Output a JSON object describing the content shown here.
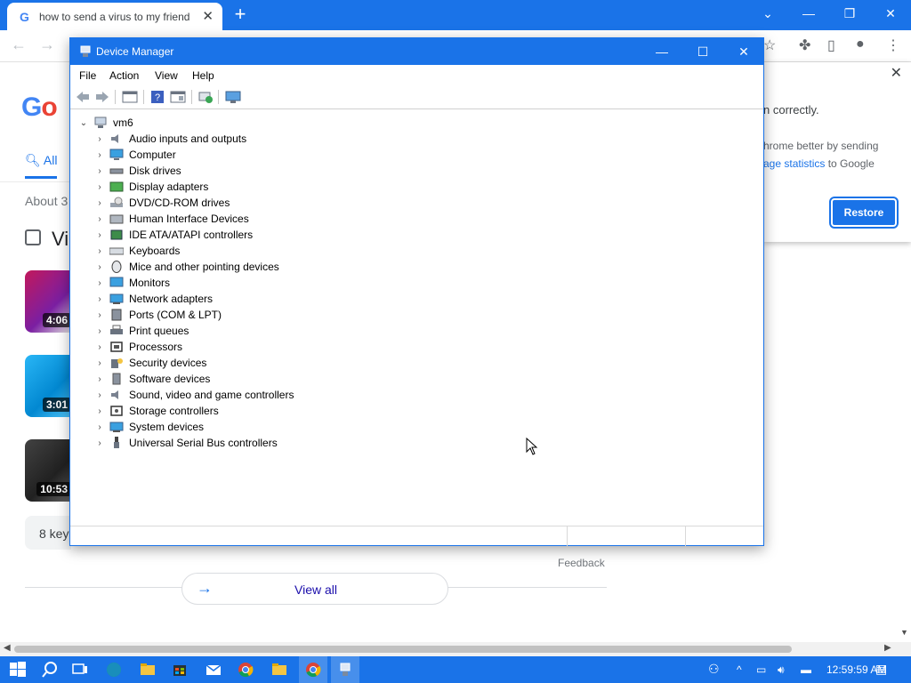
{
  "browser": {
    "tab_title": "how to send a virus to my friend",
    "tab_favicon": "G",
    "accent": "#1a73e8"
  },
  "google": {
    "all_tab": "All",
    "about_text": "About 3",
    "videos_title": "Vi",
    "videos": [
      {
        "duration": "4:06"
      },
      {
        "duration": "3:01"
      },
      {
        "duration": "10:53"
      }
    ],
    "key_moments": "8 key",
    "feedback": "Feedback",
    "view_all": "View all"
  },
  "restore_popup": {
    "line1": "n correctly.",
    "line2": "hrome better by sending",
    "line3_link": "age statistics",
    "line3_rest": " to Google",
    "restore_button": "Restore"
  },
  "device_manager": {
    "title": "Device Manager",
    "menu": [
      "File",
      "Action",
      "View",
      "Help"
    ],
    "root": "vm6",
    "categories": [
      "Audio inputs and outputs",
      "Computer",
      "Disk drives",
      "Display adapters",
      "DVD/CD-ROM drives",
      "Human Interface Devices",
      "IDE ATA/ATAPI controllers",
      "Keyboards",
      "Mice and other pointing devices",
      "Monitors",
      "Network adapters",
      "Ports (COM & LPT)",
      "Print queues",
      "Processors",
      "Security devices",
      "Software devices",
      "Sound, video and game controllers",
      "Storage controllers",
      "System devices",
      "Universal Serial Bus controllers"
    ]
  },
  "taskbar": {
    "clock": "12:59:59 AM"
  }
}
